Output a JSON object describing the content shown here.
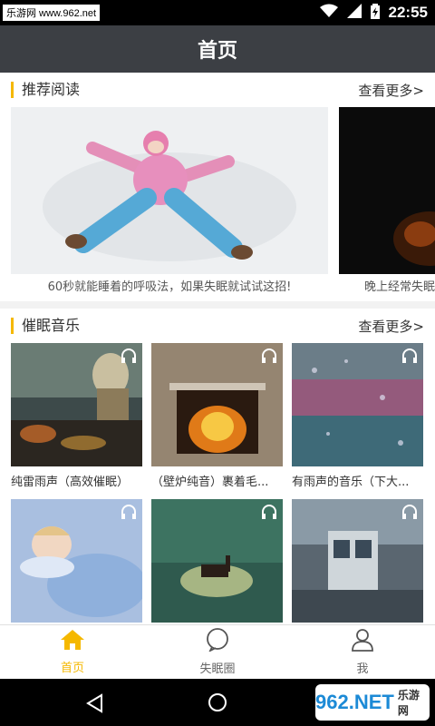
{
  "status_bar": {
    "watermark": "乐游网 www.962.net",
    "time": "22:55"
  },
  "app_bar": {
    "title": "首页"
  },
  "recommended": {
    "title": "推荐阅读",
    "more": "查看更多>",
    "items": [
      {
        "caption": "60秒就能睡着的呼吸法，如果失眠就试试这招!"
      },
      {
        "caption": "晚上经常失眠"
      }
    ]
  },
  "music": {
    "title": "催眠音乐",
    "more": "查看更多>",
    "items": [
      {
        "caption": "纯雷雨声（高效催眠）"
      },
      {
        "caption": "（壁炉纯音）裹着毛..."
      },
      {
        "caption": "有雨声的音乐（下大..."
      },
      {
        "caption": ""
      },
      {
        "caption": ""
      },
      {
        "caption": ""
      }
    ]
  },
  "tab_bar": {
    "tabs": [
      {
        "label": "首页",
        "active": true
      },
      {
        "label": "失眠圈",
        "active": false
      },
      {
        "label": "我",
        "active": false
      }
    ]
  },
  "nav_logo": {
    "text": "962.NET",
    "subtext": "乐游网"
  },
  "colors": {
    "accent": "#f5b800",
    "app_bar": "#3c3f44"
  }
}
